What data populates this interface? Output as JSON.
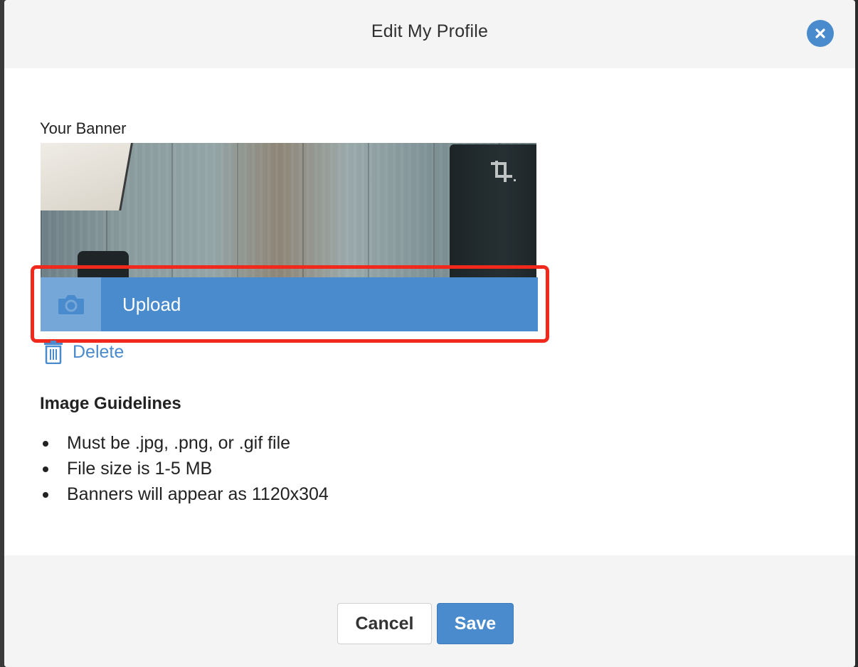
{
  "modal": {
    "title": "Edit My Profile",
    "close_icon": "close-icon"
  },
  "banner": {
    "label": "Your Banner",
    "crop_icon": "crop-icon",
    "upload_label": "Upload",
    "upload_icon": "camera-icon",
    "delete_label": "Delete",
    "delete_icon": "trash-icon"
  },
  "guidelines": {
    "title": "Image Guidelines",
    "items": [
      "Must be .jpg, .png, or .gif file",
      "File size is 1-5 MB",
      "Banners will appear as 1120x304"
    ]
  },
  "footer": {
    "cancel_label": "Cancel",
    "save_label": "Save"
  },
  "colors": {
    "accent": "#4a8bcd",
    "highlight": "#f1281c",
    "header_bg": "#f4f4f4"
  }
}
